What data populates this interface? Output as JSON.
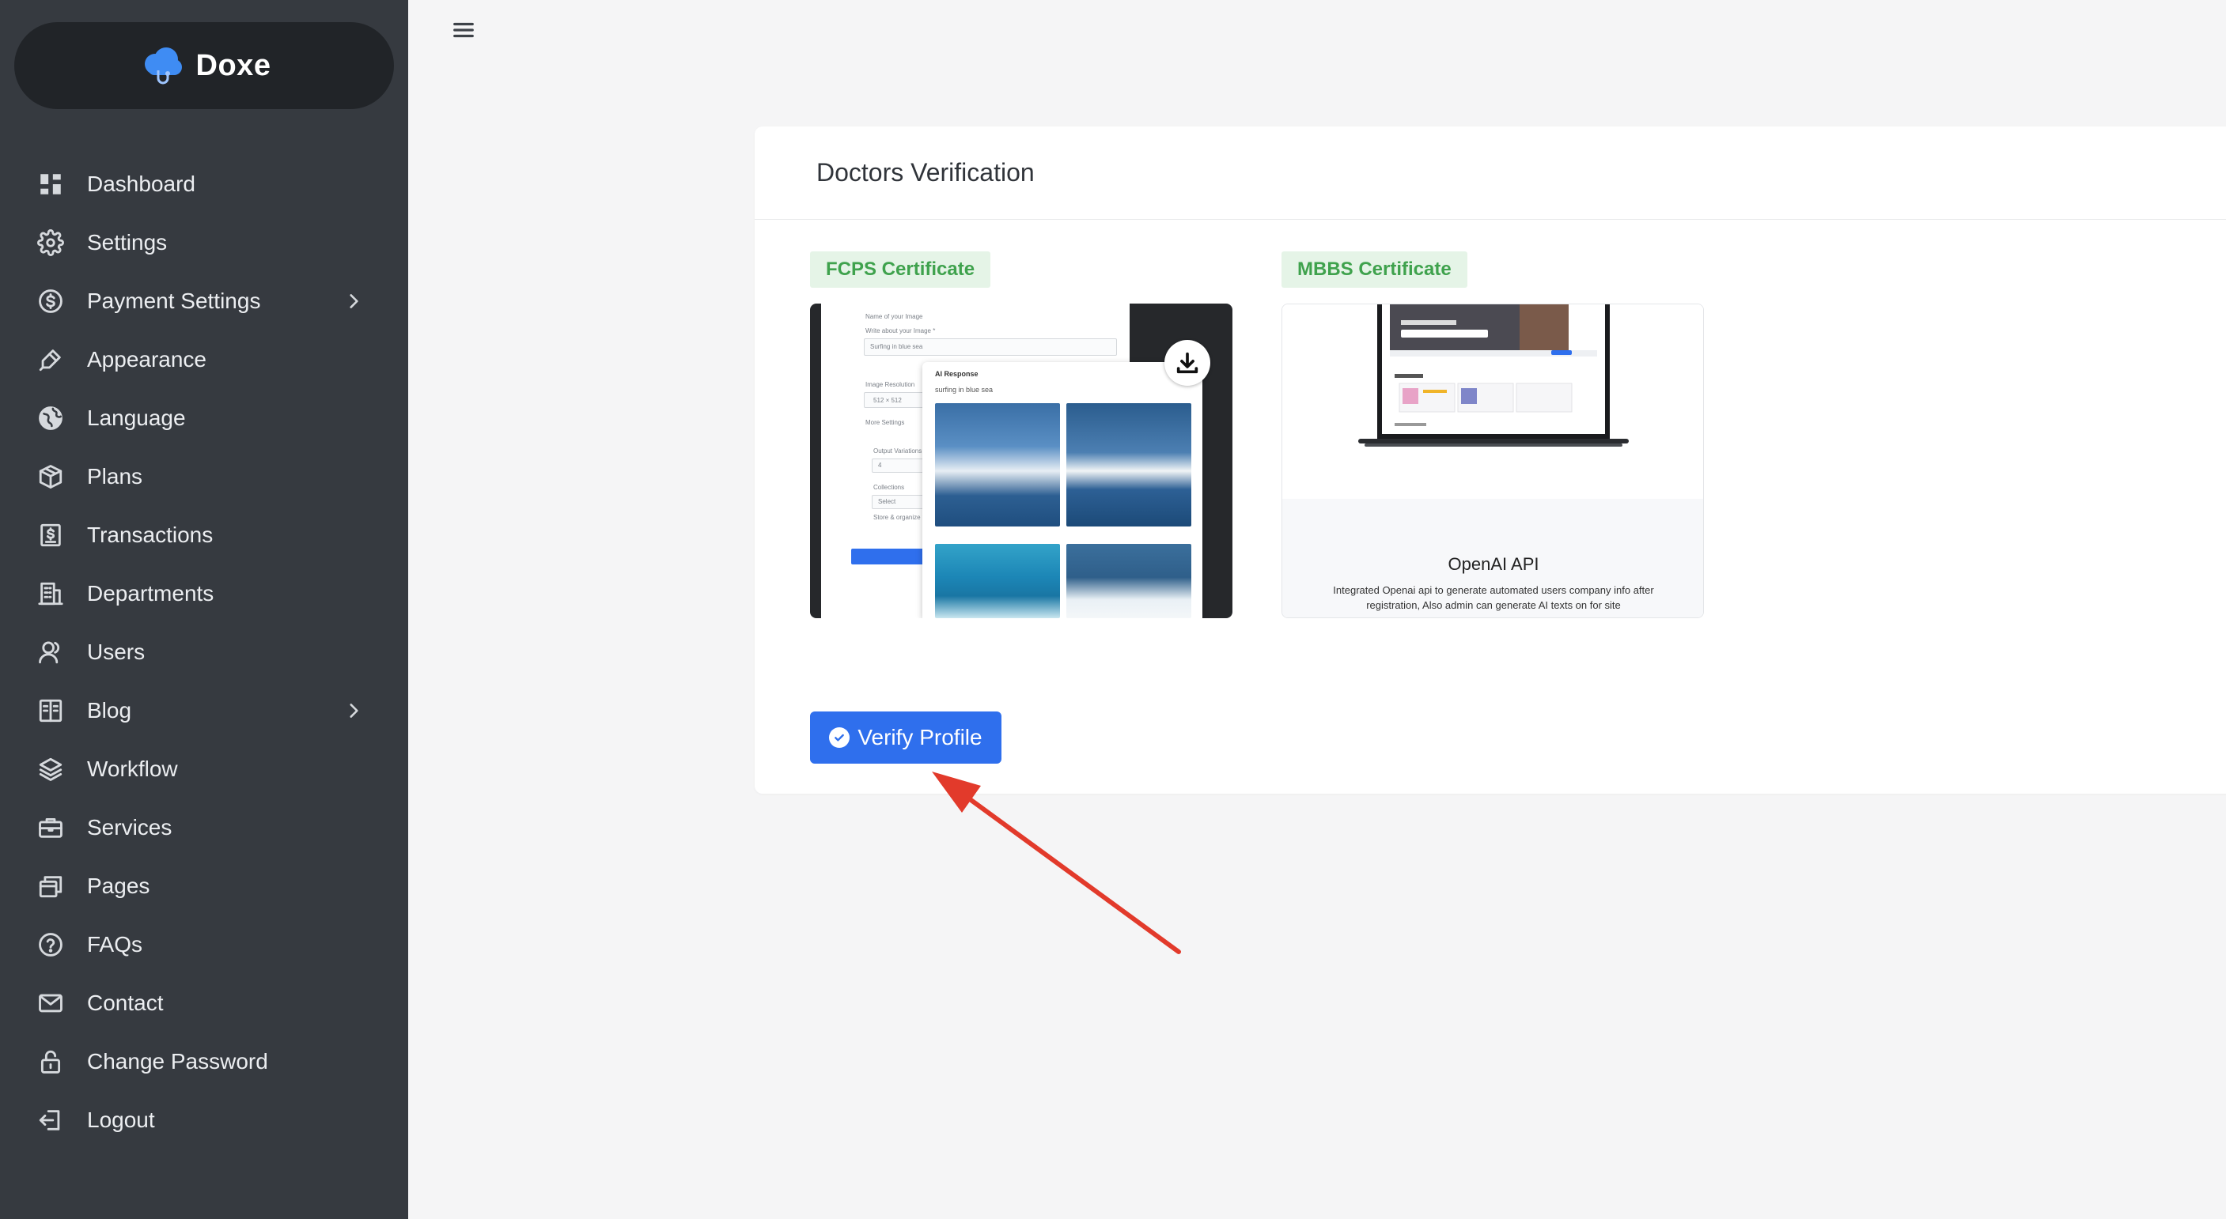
{
  "brand": {
    "name": "Doxe"
  },
  "sidebar": {
    "items": [
      {
        "label": "Dashboard",
        "icon": "dashboard-icon",
        "has_submenu": false
      },
      {
        "label": "Settings",
        "icon": "gear-icon",
        "has_submenu": false
      },
      {
        "label": "Payment Settings",
        "icon": "dollar-circle-icon",
        "has_submenu": true
      },
      {
        "label": "Appearance",
        "icon": "brush-icon",
        "has_submenu": false
      },
      {
        "label": "Language",
        "icon": "globe-icon",
        "has_submenu": false
      },
      {
        "label": "Plans",
        "icon": "box-icon",
        "has_submenu": false
      },
      {
        "label": "Transactions",
        "icon": "receipt-icon",
        "has_submenu": false
      },
      {
        "label": "Departments",
        "icon": "building-icon",
        "has_submenu": false
      },
      {
        "label": "Users",
        "icon": "user-icon",
        "has_submenu": false
      },
      {
        "label": "Blog",
        "icon": "book-icon",
        "has_submenu": true
      },
      {
        "label": "Workflow",
        "icon": "layers-icon",
        "has_submenu": false
      },
      {
        "label": "Services",
        "icon": "briefcase-icon",
        "has_submenu": false
      },
      {
        "label": "Pages",
        "icon": "pages-icon",
        "has_submenu": false
      },
      {
        "label": "FAQs",
        "icon": "question-circle-icon",
        "has_submenu": false
      },
      {
        "label": "Contact",
        "icon": "mail-icon",
        "has_submenu": false
      },
      {
        "label": "Change Password",
        "icon": "lock-icon",
        "has_submenu": false
      },
      {
        "label": "Logout",
        "icon": "logout-icon",
        "has_submenu": false
      }
    ]
  },
  "topbar": {
    "menu_icon": "hamburger-icon"
  },
  "card": {
    "title": "Doctors Verification",
    "certificates": [
      {
        "badge": "FCPS Certificate",
        "preview": {
          "form_fields": [
            "Name of your Image",
            "Write about your Image *",
            "Surfing in blue sea",
            "Image Resolution",
            "512 × 512",
            "More Settings",
            "Output Variations",
            "4",
            "Collections",
            "Select",
            "Store & organize your images"
          ],
          "ai_title": "AI Response",
          "ai_prompt": "surfing in blue sea"
        }
      },
      {
        "badge": "MBBS Certificate",
        "preview": {
          "title": "OpenAI API",
          "description": "Integrated Openai api to generate automated users company info after registration, Also admin can generate AI texts on for site"
        }
      }
    ],
    "verify_label": "Verify Profile"
  },
  "colors": {
    "sidebar_bg": "#363a40",
    "brand_bg": "#212428",
    "accent": "#2f6fed",
    "badge_bg": "#e5f4e7",
    "badge_text": "#3fa24d",
    "annotation": "#e23a2b"
  }
}
